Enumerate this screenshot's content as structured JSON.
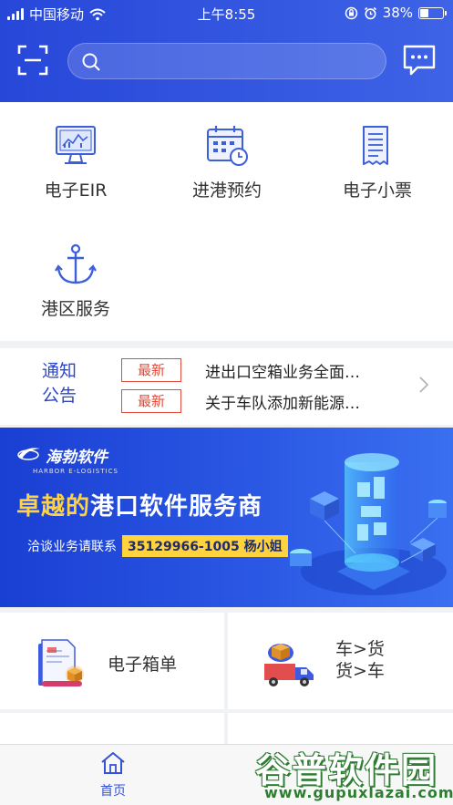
{
  "status_bar": {
    "carrier": "中国移动",
    "time": "上午8:55",
    "battery": "38%",
    "battery_level": 0.38
  },
  "header": {
    "search_placeholder": "",
    "icons": [
      "scan-icon",
      "search-icon",
      "message-icon"
    ]
  },
  "quick_functions": [
    {
      "label": "电子EIR",
      "icon": "monitor-chart-icon"
    },
    {
      "label": "进港预约",
      "icon": "calendar-clock-icon"
    },
    {
      "label": "电子小票",
      "icon": "receipt-icon"
    },
    {
      "label": "港区服务",
      "icon": "anchor-icon"
    }
  ],
  "notice": {
    "title_line1": "通知",
    "title_line2": "公告",
    "items": [
      {
        "badge": "最新",
        "text": "进出口空箱业务全面…"
      },
      {
        "badge": "最新",
        "text": "关于车队添加新能源…"
      }
    ]
  },
  "banner": {
    "brand_cn": "海勃软件",
    "brand_en": "HARBOR E-LOGISTICS",
    "headline_highlight": "卓越的",
    "headline_rest": "港口软件服务商",
    "contact_label": "洽谈业务请联系",
    "contact_phone": "35129966-1005 杨小姐"
  },
  "services": [
    {
      "label": "电子箱单",
      "icon": "document-box-icon"
    },
    {
      "label_line1": "车>货",
      "label_line2": "货>车",
      "icon": "truck-cargo-icon"
    }
  ],
  "tab_bar": {
    "home_label": "首页"
  },
  "watermark": {
    "name": "谷普软件园",
    "url": "www.gupuxlazai.com"
  },
  "colors": {
    "header_blue": "#2f4fde",
    "accent_blue": "#3552d6",
    "badge_red": "#e04b3a",
    "banner_yellow": "#ffd23f"
  }
}
